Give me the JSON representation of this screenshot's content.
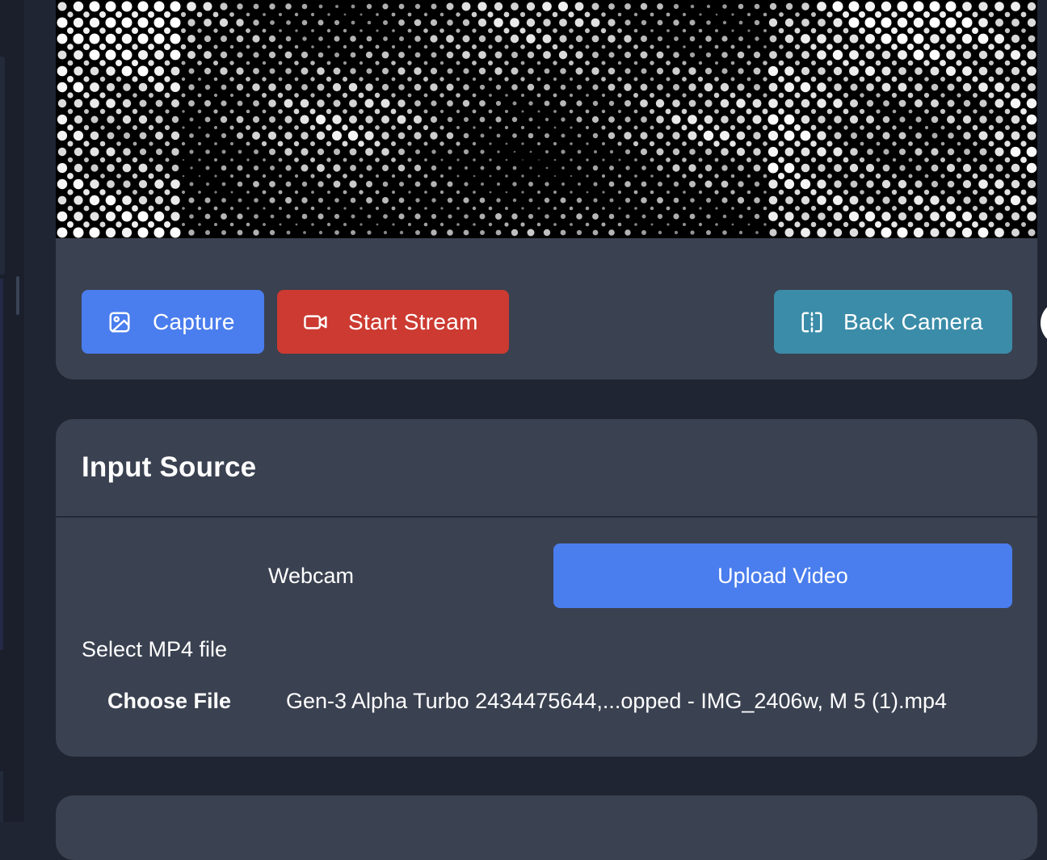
{
  "camera": {
    "capture_label": "Capture",
    "stream_label": "Start Stream",
    "back_camera_label": "Back Camera"
  },
  "input_source": {
    "title": "Input Source",
    "tabs": [
      {
        "label": "Webcam",
        "active": false
      },
      {
        "label": "Upload Video",
        "active": true
      }
    ],
    "file_label": "Select MP4 file",
    "choose_file_label": "Choose File",
    "file_name": "Gen-3 Alpha Turbo 2434475644,...opped - IMG_2406w, M 5 (1).mp4"
  },
  "colors": {
    "capture": "#4a7ded",
    "stream": "#cc3a31",
    "back_camera": "#3b8ca8",
    "active_tab": "#4a7ded",
    "card": "#3a4150",
    "background": "#1f2532"
  },
  "icons": {
    "capture": "image-icon",
    "stream": "video-camera-icon",
    "back_camera": "flip-camera-icon"
  }
}
